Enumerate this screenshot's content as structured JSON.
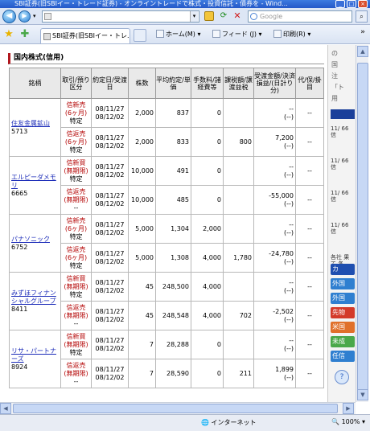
{
  "window": {
    "title": "SBI証券(旧SBIイー・トレード証券) - オンライントレードで株式・投資信託・債券を - Wind..."
  },
  "address_bar": {
    "url": "",
    "search_placeholder": "Google"
  },
  "tabs": [
    {
      "label": "SBI証券(旧SBIイー・トレ..."
    }
  ],
  "commands": {
    "home": "ホーム(M)",
    "feed": "フィード (J)",
    "print": "印刷(R)"
  },
  "section": {
    "title": "国内株式(信用)"
  },
  "table": {
    "headers": {
      "name": "銘柄",
      "trade": "取引/預り区分",
      "date": "約定日/受渡日",
      "qty": "株数",
      "avg": "平均約定/単価",
      "fee": "手数料/諸経費等",
      "tax": "課税額/譲渡益税",
      "pnl": "受渡金額/決済損益/(日計り分)",
      "agent": "代/保/掛目"
    },
    "groups": [
      {
        "name": "住友金属鉱山",
        "code": "5713",
        "rows": [
          {
            "type": "信新売",
            "term": "(6ヶ月)",
            "acct": "特定",
            "d1": "08/11/27",
            "d2": "08/12/02",
            "qty": "2,000",
            "price": "837",
            "fee": "0",
            "tax": "",
            "pnl1": "--",
            "pnl2": "(--)",
            "agent": "--"
          },
          {
            "type": "信返売",
            "term": "(6ヶ月)",
            "acct": "特定",
            "d1": "08/11/27",
            "d2": "08/12/02",
            "qty": "2,000",
            "price": "833",
            "fee": "0",
            "tax": "800",
            "pnl1": "7,200",
            "pnl2": "(--)",
            "agent": "--"
          }
        ]
      },
      {
        "name": "エルピーダメモリ",
        "code": "6665",
        "rows": [
          {
            "type": "信新買",
            "term": "(無期限)",
            "acct": "特定",
            "d1": "08/11/27",
            "d2": "08/12/02",
            "qty": "10,000",
            "price": "491",
            "fee": "0",
            "tax": "",
            "pnl1": "--",
            "pnl2": "(--)",
            "agent": "--"
          },
          {
            "type": "信返売",
            "term": "(無期限)",
            "acct": "--",
            "d1": "08/11/27",
            "d2": "08/12/02",
            "qty": "10,000",
            "price": "485",
            "fee": "0",
            "tax": "",
            "pnl1": "-55,000",
            "pnl2": "(--)",
            "agent": "--"
          }
        ]
      },
      {
        "name": "パナソニック",
        "code": "6752",
        "rows": [
          {
            "type": "信新売",
            "term": "(6ヶ月)",
            "acct": "特定",
            "d1": "08/11/27",
            "d2": "08/12/02",
            "qty": "5,000",
            "price": "1,304",
            "fee": "2,000",
            "tax": "",
            "pnl1": "--",
            "pnl2": "(--)",
            "agent": "--"
          },
          {
            "type": "信返売",
            "term": "(6ヶ月)",
            "acct": "特定",
            "d1": "08/11/27",
            "d2": "08/12/02",
            "qty": "5,000",
            "price": "1,308",
            "fee": "4,000",
            "tax": "1,780",
            "pnl1": "-24,780",
            "pnl2": "(--)",
            "agent": "--"
          }
        ]
      },
      {
        "name": "みずほフィナンシャルグループ",
        "code": "8411",
        "rows": [
          {
            "type": "信新買",
            "term": "(無期限)",
            "acct": "特定",
            "d1": "08/11/27",
            "d2": "08/12/02",
            "qty": "45",
            "price": "248,500",
            "fee": "4,000",
            "tax": "",
            "pnl1": "--",
            "pnl2": "(--)",
            "agent": "--"
          },
          {
            "type": "信返売",
            "term": "(無期限)",
            "acct": "--",
            "d1": "08/11/27",
            "d2": "08/12/02",
            "qty": "45",
            "price": "248,548",
            "fee": "4,000",
            "tax": "702",
            "pnl1": "-2,502",
            "pnl2": "(--)",
            "agent": "--"
          }
        ]
      },
      {
        "name": "リサ・パートナーズ",
        "code": "8924",
        "rows": [
          {
            "type": "信新買",
            "term": "(無期限)",
            "acct": "特定",
            "d1": "08/11/27",
            "d2": "08/12/02",
            "qty": "7",
            "price": "28,288",
            "fee": "0",
            "tax": "",
            "pnl1": "--",
            "pnl2": "(--)",
            "agent": "--"
          },
          {
            "type": "信返売",
            "term": "(無期限)",
            "acct": "--",
            "d1": "08/11/27",
            "d2": "08/12/02",
            "qty": "7",
            "price": "28,590",
            "fee": "0",
            "tax": "211",
            "pnl1": "1,899",
            "pnl2": "(--)",
            "agent": "--"
          }
        ]
      }
    ]
  },
  "right_panel": {
    "top_texts": [
      "の",
      "国",
      "注",
      "「ト",
      "用"
    ],
    "items": [
      "11/ 66 信",
      "11/ 66 信",
      "11/ 66 信",
      "11/ 66 信",
      "各社 果 て 各"
    ],
    "buttons": [
      {
        "label": "カ",
        "color": "#1f4fb0"
      },
      {
        "label": "外国",
        "color": "#2f7fd0"
      },
      {
        "label": "外国",
        "color": "#2f7fd0"
      },
      {
        "label": "先物",
        "color": "#d33a2a"
      },
      {
        "label": "米国",
        "color": "#e0702a"
      },
      {
        "label": "未成",
        "color": "#4aa84a"
      },
      {
        "label": "任信",
        "color": "#2f7fd0"
      }
    ]
  },
  "status": {
    "zone": "インターネット",
    "zoom": "100%"
  }
}
